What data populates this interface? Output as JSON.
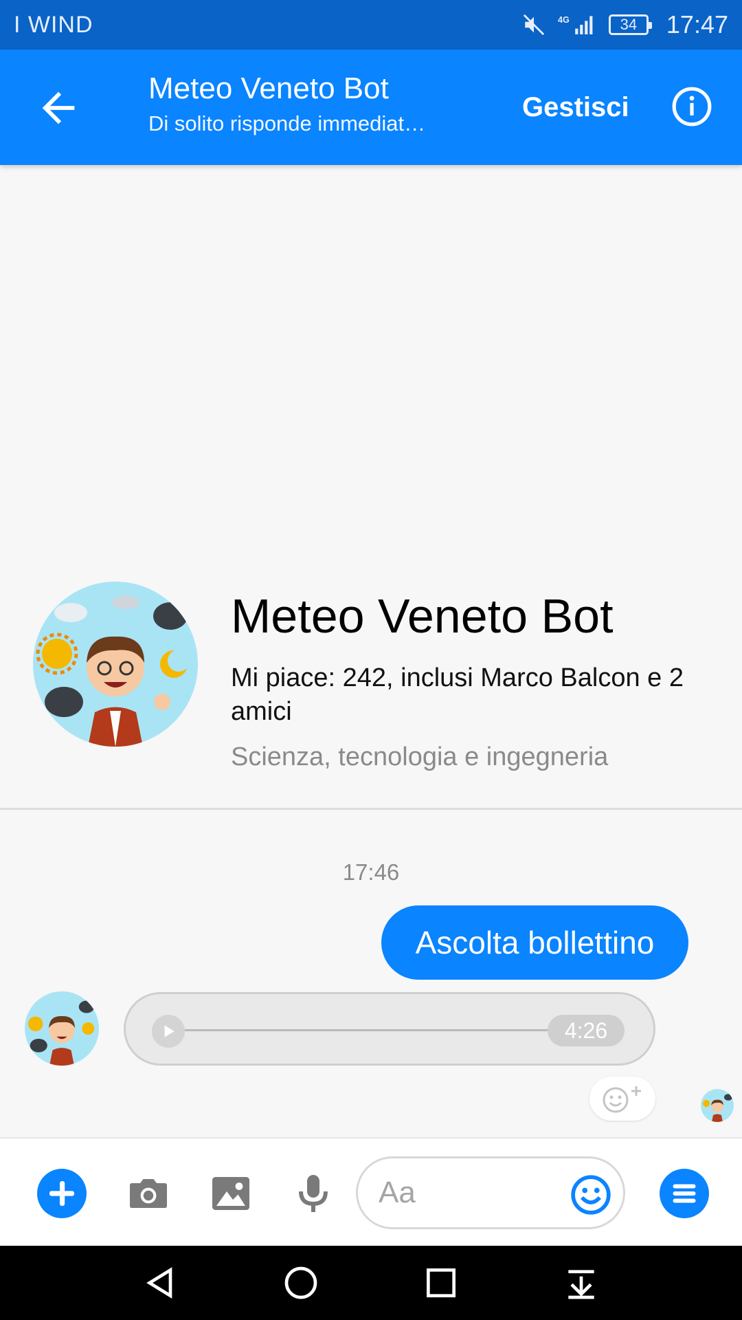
{
  "status_bar": {
    "carrier": "I WIND",
    "network": "4G",
    "battery": "34",
    "time": "17:47"
  },
  "app_bar": {
    "title": "Meteo Veneto Bot",
    "subtitle": "Di solito risponde immediat…",
    "manage_label": "Gestisci"
  },
  "profile": {
    "name": "Meteo Veneto Bot",
    "likes": "Mi piace: 242, inclusi Marco Balcon e 2 amici",
    "category": "Scienza, tecnologia e ingegneria"
  },
  "conversation": {
    "timestamp": "17:46",
    "messages": [
      {
        "sender": "me",
        "type": "text",
        "text": "Ascolta bollettino"
      },
      {
        "sender": "bot",
        "type": "audio",
        "duration": "4:26",
        "progress": 0
      }
    ]
  },
  "composer": {
    "placeholder": "Aa"
  },
  "colors": {
    "status_bar": "#0a63c7",
    "app_bar": "#0a84ff",
    "accent": "#0a84ff",
    "background": "#f7f7f7"
  },
  "icons": {
    "back": "arrow-left-icon",
    "info": "info-icon",
    "add": "plus-icon",
    "camera": "camera-icon",
    "gallery": "image-icon",
    "microphone": "microphone-icon",
    "emoji": "smiley-icon",
    "menu": "menu-icon",
    "react": "add-reaction-icon"
  }
}
